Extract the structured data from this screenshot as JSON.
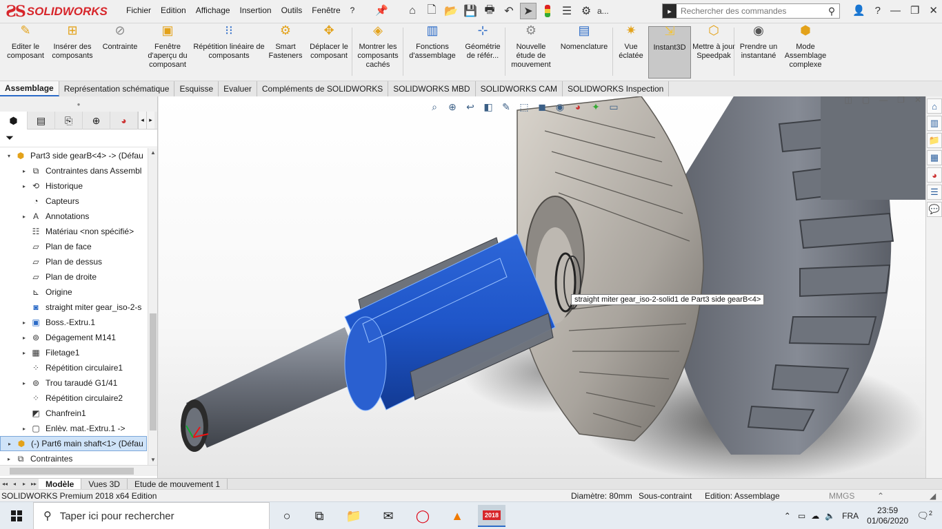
{
  "app": {
    "brand": "SOLIDWORKS",
    "brand_color": "#d7262b"
  },
  "menu": [
    "Fichier",
    "Edition",
    "Affichage",
    "Insertion",
    "Outils",
    "Fenêtre",
    "?"
  ],
  "toolbar_overflow": "a...",
  "command_search": {
    "placeholder": "Rechercher des commandes"
  },
  "ribbon": [
    {
      "label": "Editer le composant",
      "icon": "edit-component-icon"
    },
    {
      "label": "Insérer des composants",
      "icon": "insert-components-icon"
    },
    {
      "label": "Contrainte",
      "icon": "mate-icon"
    },
    {
      "label": "Fenêtre d'aperçu du composant",
      "icon": "component-preview-window-icon"
    },
    {
      "label": "Répétition linéaire de composants",
      "icon": "linear-pattern-icon"
    },
    {
      "label": "Smart Fasteners",
      "icon": "smart-fasteners-icon"
    },
    {
      "label": "Déplacer le composant",
      "icon": "move-component-icon"
    },
    {
      "label": "Montrer les composants cachés",
      "icon": "show-hidden-components-icon"
    },
    {
      "label": "Fonctions d'assemblage",
      "icon": "assembly-features-icon"
    },
    {
      "label": "Géométrie de référ...",
      "icon": "reference-geometry-icon"
    },
    {
      "label": "Nouvelle étude de mouvement",
      "icon": "new-motion-study-icon"
    },
    {
      "label": "Nomenclature",
      "icon": "bill-of-materials-icon"
    },
    {
      "label": "Vue éclatée",
      "icon": "exploded-view-icon"
    },
    {
      "label": "Instant3D",
      "icon": "instant3d-icon"
    },
    {
      "label": "Mettre à jour Speedpak",
      "icon": "speedpak-icon"
    },
    {
      "label": "Prendre un instantané",
      "icon": "snapshot-icon"
    },
    {
      "label": "Mode Assemblage complexe",
      "icon": "large-assembly-mode-icon"
    }
  ],
  "tabs": [
    "Assemblage",
    "Représentation schématique",
    "Esquisse",
    "Evaluer",
    "Compléments de SOLIDWORKS",
    "SOLIDWORKS MBD",
    "SOLIDWORKS CAM",
    "SOLIDWORKS Inspection"
  ],
  "tree": [
    {
      "label": "Part3 side gearB<4> -> (Défau",
      "icon": "part-icon",
      "exp": "v"
    },
    {
      "label": "Contraintes dans Assembl",
      "icon": "mates-folder-icon",
      "exp": ">"
    },
    {
      "label": "Historique",
      "icon": "history-icon",
      "exp": ">"
    },
    {
      "label": "Capteurs",
      "icon": "sensors-icon",
      "exp": ""
    },
    {
      "label": "Annotations",
      "icon": "annotations-icon",
      "exp": ">"
    },
    {
      "label": "Matériau <non spécifié>",
      "icon": "material-icon",
      "exp": ""
    },
    {
      "label": "Plan de face",
      "icon": "plane-icon",
      "exp": ""
    },
    {
      "label": "Plan de dessus",
      "icon": "plane-icon",
      "exp": ""
    },
    {
      "label": "Plan de droite",
      "icon": "plane-icon",
      "exp": ""
    },
    {
      "label": "Origine",
      "icon": "origin-icon",
      "exp": ""
    },
    {
      "label": "straight miter gear_iso-2-s",
      "icon": "solid-body-icon",
      "exp": ""
    },
    {
      "label": "Boss.-Extru.1",
      "icon": "extrude-icon",
      "exp": ">"
    },
    {
      "label": "Dégagement M141",
      "icon": "hole-wizard-icon",
      "exp": ">"
    },
    {
      "label": "Filetage1",
      "icon": "thread-icon",
      "exp": ">"
    },
    {
      "label": "Répétition circulaire1",
      "icon": "circular-pattern-icon",
      "exp": ""
    },
    {
      "label": "Trou taraudé G1/41",
      "icon": "hole-wizard-icon",
      "exp": ">"
    },
    {
      "label": "Répétition circulaire2",
      "icon": "circular-pattern-icon",
      "exp": ""
    },
    {
      "label": "Chanfrein1",
      "icon": "chamfer-icon",
      "exp": ""
    },
    {
      "label": "Enlèv. mat.-Extru.1 ->",
      "icon": "cut-extrude-icon",
      "exp": ">"
    },
    {
      "label": "(-) Part6 main shaft<1> (Défau",
      "icon": "part-icon",
      "exp": ">"
    },
    {
      "label": "Contraintes",
      "icon": "mates-folder-icon",
      "exp": ">"
    }
  ],
  "viewport": {
    "tooltip": "straight miter gear_iso-2-solid1 de Part3 side gearB<4>"
  },
  "bottom_tabs": [
    "Modèle",
    "Vues 3D",
    "Etude de mouvement 1"
  ],
  "status": {
    "left": "SOLIDWORKS Premium 2018 x64 Edition",
    "diameter": "Diamètre: 80mm",
    "constraint": "Sous-contraint",
    "edition": "Edition: Assemblage",
    "units": "MMGS"
  },
  "taskbar": {
    "search_placeholder": "Taper ici pour rechercher",
    "lang": "FRA",
    "time": "23:59",
    "date": "01/06/2020",
    "notif_count": "2",
    "sw_badge": "2018"
  },
  "colors": {
    "selection_blue": "#1f56c9",
    "gear_gray": "#c8c3bb",
    "accent": "#2a6ac7"
  }
}
